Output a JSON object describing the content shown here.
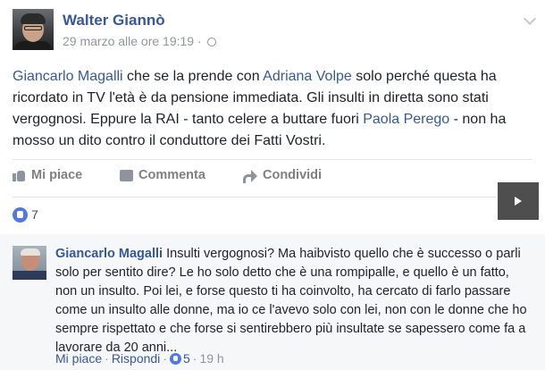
{
  "post": {
    "author": "Walter Giannò",
    "meta": "29 marzo alle ore 19:19 ·",
    "body": {
      "link1": "Giancarlo Magalli",
      "text1": " che se la prende con ",
      "link2": "Adriana Volpe",
      "text2": " solo perché questa ha ricordato in TV l'età è da pensione immediata. Gli insulti in diretta sono stati vergognosi. Eppure la RAI - tanto celere a buttare fuori ",
      "link3": "Paola Perego",
      "text3": " - non ha mosso un dito contro il conduttore dei Fatti Vostri."
    }
  },
  "actions": {
    "like": "Mi piace",
    "comment": "Commenta",
    "share": "Condividi"
  },
  "reactions": {
    "count": "7"
  },
  "comment": {
    "author": "Giancarlo Magalli",
    "text": " Insulti vergognosi? Ma haibvisto quello che è successo o parli solo per sentito dire? Le ho solo detto che è una rompipalle, e quello è un fatto, non un insulto. Poi lei, e forse questo ti ha coinvolto, ha cercato di farlo passare come un insulto alle donne, ma io ce l'avevo solo con lei, non con le donne che ho sempre rispettato e che forse si sentirebbero più insultate se sapessero come fa a lavorare da 20 anni...",
    "like_label": "Mi piace",
    "reply_label": "Rispondi",
    "likes": "5",
    "time": "19 h"
  },
  "icons": {
    "accent": "#365899",
    "like_blue": "#4f7ae0",
    "items": [
      "globe-icon",
      "chevron-down-icon",
      "like-icon",
      "comment-icon",
      "share-icon",
      "play-icon"
    ]
  }
}
